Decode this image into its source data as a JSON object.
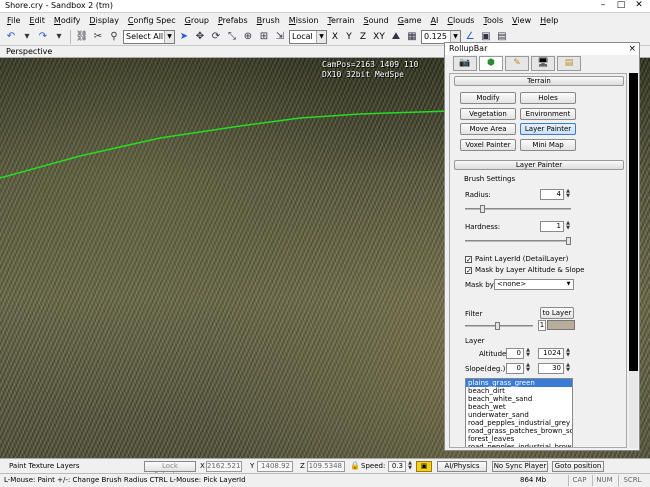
{
  "window": {
    "title": "Shore.cry - Sandbox 2 (tm)"
  },
  "menu": [
    "File",
    "Edit",
    "Modify",
    "Display",
    "Config Spec",
    "Group",
    "Prefabs",
    "Brush",
    "Mission",
    "Terrain",
    "Sound",
    "Game",
    "AI",
    "Clouds",
    "Tools",
    "View",
    "Help"
  ],
  "toolbar": {
    "selection": "Select All",
    "coord_system": "Local",
    "axes": [
      "X",
      "Y",
      "Z",
      "XY"
    ],
    "grid_value": "0.125"
  },
  "viewport": {
    "name": "Perspective",
    "campos_line1": "CamPos=2163 1409 110",
    "campos_line2": "DX10 32bit MedSpe"
  },
  "rollup": {
    "title": "RollupBar",
    "close": "×",
    "terrain_header": "Terrain",
    "buttons": [
      {
        "label": "Modify",
        "active": false
      },
      {
        "label": "Holes",
        "active": false
      },
      {
        "label": "Vegetation",
        "active": false
      },
      {
        "label": "Environment",
        "active": false
      },
      {
        "label": "Move Area",
        "active": false
      },
      {
        "label": "Layer Painter",
        "active": true
      },
      {
        "label": "Voxel Painter",
        "active": false
      },
      {
        "label": "Mini Map",
        "active": false
      }
    ],
    "layer_painter_header": "Layer Painter",
    "brush_settings": "Brush Settings",
    "radius_label": "Radius:",
    "radius_value": "4",
    "radius_fraction": 0.15,
    "hardness_label": "Hardness:",
    "hardness_value": "1",
    "hardness_fraction": 1.0,
    "paint_layer_label": "Paint LayerId (DetailLayer)",
    "paint_layer_checked": true,
    "mask_label": "Mask by Layer Altitude & Slope",
    "mask_checked": true,
    "mask_by_label": "Mask by",
    "mask_by_value": "<none>",
    "filter_label": "Filter",
    "to_layer_label": "to Layer",
    "filter_value": "1",
    "filter_color": "#b7ad9a",
    "layer_label": "Layer",
    "altitude_label": "Altitude",
    "altitude_min": "0",
    "altitude_max": "1024",
    "slope_label": "Slope(deg.)",
    "slope_min": "0",
    "slope_max": "30",
    "layers": [
      "plains_grass_green",
      "beach_dirt",
      "beach_white_sand",
      "beach_wet",
      "underwater_sand",
      "road_pepples_industrial_grey",
      "road_grass_patches_brown_soil",
      "forest_leaves",
      "road_pepples_industrial_brown"
    ],
    "selected_layer": 0
  },
  "status": {
    "paint_label": "Paint Texture Layers",
    "lock_selection": "Lock Selection",
    "x_label": "X",
    "x_value": "2162.521",
    "y_label": "Y",
    "y_value": "1408.92",
    "z_label": "Z",
    "z_value": "109.5348",
    "speed_label": "Speed:",
    "speed_value": "0.3",
    "ai_physics": "AI/Physics",
    "no_sync": "No Sync Player",
    "goto_position": "Goto position",
    "hint": "L-Mouse: Paint    +/-: Change Brush Radius    CTRL L-Mouse: Pick LayerId",
    "memory": "864 Mb",
    "cap": "CAP",
    "num": "NUM",
    "scrl": "SCRL"
  },
  "colors": {
    "active_blue": "#3a7bd5",
    "terrain_line": "#22dd22"
  }
}
